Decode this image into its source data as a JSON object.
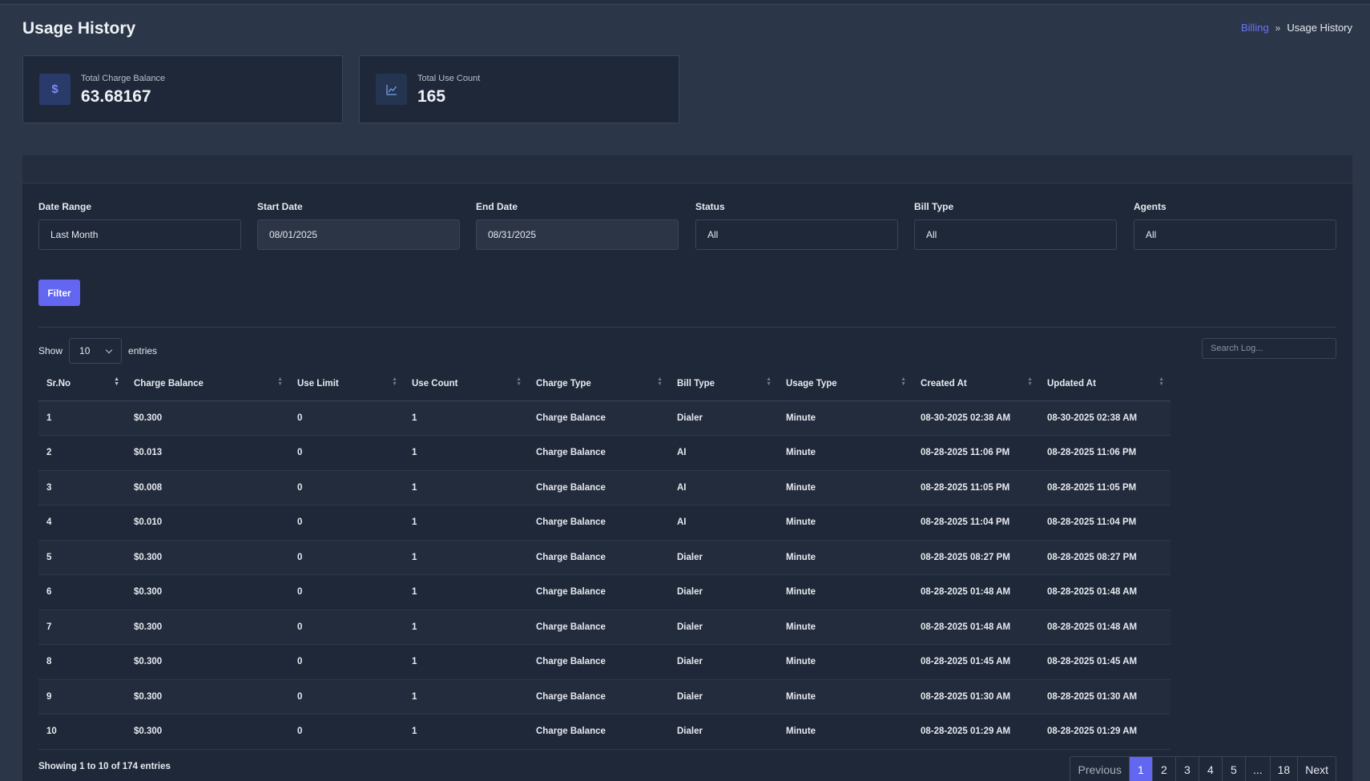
{
  "page": {
    "title": "Usage History"
  },
  "breadcrumb": {
    "parent": "Billing",
    "separator": "»",
    "current": "Usage History"
  },
  "stats": [
    {
      "icon": "dollar-icon",
      "glyph": "$",
      "label": "Total Charge Balance",
      "value": "63.68167"
    },
    {
      "icon": "line-chart-icon",
      "label": "Total Use Count",
      "value": "165"
    }
  ],
  "filters": {
    "date_range": {
      "label": "Date Range",
      "value": "Last Month"
    },
    "start_date": {
      "label": "Start Date",
      "value": "08/01/2025"
    },
    "end_date": {
      "label": "End Date",
      "value": "08/31/2025"
    },
    "status": {
      "label": "Status",
      "value": "All"
    },
    "bill_type": {
      "label": "Bill Type",
      "value": "All"
    },
    "agents": {
      "label": "Agents",
      "value": "All"
    },
    "button": "Filter"
  },
  "table_controls": {
    "show": "Show",
    "entries_value": "10",
    "entries": "entries",
    "search_placeholder": "Search Log..."
  },
  "table": {
    "columns": [
      "Sr.No",
      "Charge Balance",
      "Use Limit",
      "Use Count",
      "Charge Type",
      "Bill Type",
      "Usage Type",
      "Created At",
      "Updated At"
    ],
    "rows": [
      [
        "1",
        "$0.300",
        "0",
        "1",
        "Charge Balance",
        "Dialer",
        "Minute",
        "08-30-2025 02:38 AM",
        "08-30-2025 02:38 AM"
      ],
      [
        "2",
        "$0.013",
        "0",
        "1",
        "Charge Balance",
        "AI",
        "Minute",
        "08-28-2025 11:06 PM",
        "08-28-2025 11:06 PM"
      ],
      [
        "3",
        "$0.008",
        "0",
        "1",
        "Charge Balance",
        "AI",
        "Minute",
        "08-28-2025 11:05 PM",
        "08-28-2025 11:05 PM"
      ],
      [
        "4",
        "$0.010",
        "0",
        "1",
        "Charge Balance",
        "AI",
        "Minute",
        "08-28-2025 11:04 PM",
        "08-28-2025 11:04 PM"
      ],
      [
        "5",
        "$0.300",
        "0",
        "1",
        "Charge Balance",
        "Dialer",
        "Minute",
        "08-28-2025 08:27 PM",
        "08-28-2025 08:27 PM"
      ],
      [
        "6",
        "$0.300",
        "0",
        "1",
        "Charge Balance",
        "Dialer",
        "Minute",
        "08-28-2025 01:48 AM",
        "08-28-2025 01:48 AM"
      ],
      [
        "7",
        "$0.300",
        "0",
        "1",
        "Charge Balance",
        "Dialer",
        "Minute",
        "08-28-2025 01:48 AM",
        "08-28-2025 01:48 AM"
      ],
      [
        "8",
        "$0.300",
        "0",
        "1",
        "Charge Balance",
        "Dialer",
        "Minute",
        "08-28-2025 01:45 AM",
        "08-28-2025 01:45 AM"
      ],
      [
        "9",
        "$0.300",
        "0",
        "1",
        "Charge Balance",
        "Dialer",
        "Minute",
        "08-28-2025 01:30 AM",
        "08-28-2025 01:30 AM"
      ],
      [
        "10",
        "$0.300",
        "0",
        "1",
        "Charge Balance",
        "Dialer",
        "Minute",
        "08-28-2025 01:29 AM",
        "08-28-2025 01:29 AM"
      ]
    ]
  },
  "footer": {
    "info": "Showing 1 to 10 of 174 entries",
    "pagination": {
      "previous": "Previous",
      "pages": [
        "1",
        "2",
        "3",
        "4",
        "5",
        "...",
        "18"
      ],
      "current": "1",
      "next": "Next"
    }
  },
  "colors": {
    "accent": "#6266f1",
    "background": "#2b3648",
    "panel": "#1f2838"
  }
}
